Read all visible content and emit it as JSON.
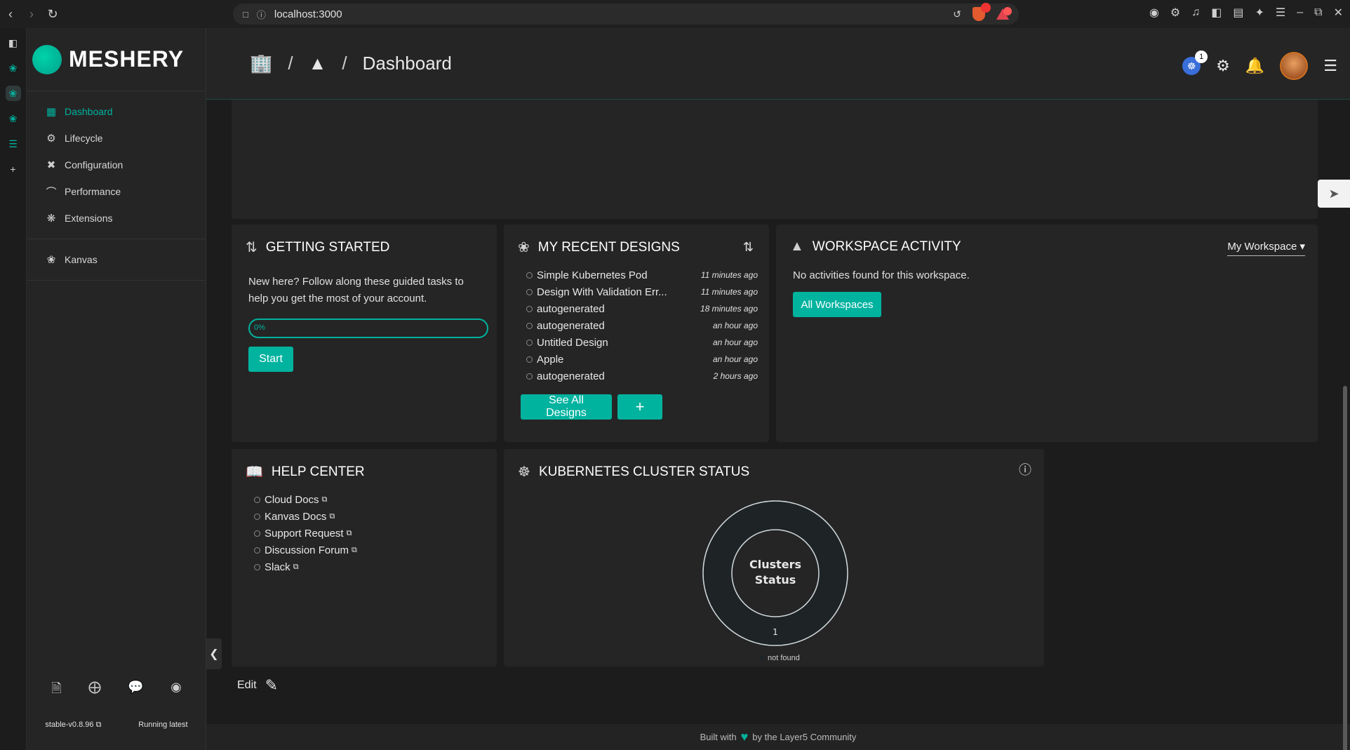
{
  "browser": {
    "url": "localhost:3000",
    "brave_badge": "",
    "back_label": "‹",
    "forward_label": "›",
    "reload_label": "↻"
  },
  "brand": {
    "name": "MESHERY"
  },
  "sidebar": {
    "items": [
      {
        "label": "Dashboard",
        "icon": "dashboard-icon",
        "active": true
      },
      {
        "label": "Lifecycle",
        "icon": "gears-icon"
      },
      {
        "label": "Configuration",
        "icon": "tools-icon"
      },
      {
        "label": "Performance",
        "icon": "gauge-icon"
      },
      {
        "label": "Extensions",
        "icon": "extensions-icon"
      }
    ],
    "extra_items": [
      {
        "label": "Kanvas",
        "icon": "kanvas-icon"
      }
    ],
    "version": "stable-v0.8.96",
    "running": "Running latest"
  },
  "header": {
    "breadcrumb_current": "Dashboard",
    "notification_count": "1"
  },
  "getting_started": {
    "title": "GETTING STARTED",
    "text": "New here? Follow along these guided tasks to help you get the most of your account.",
    "progress_label": "0%",
    "progress": 0,
    "start_label": "Start"
  },
  "recent_designs": {
    "title": "MY RECENT DESIGNS",
    "items": [
      {
        "name": "Simple Kubernetes Pod",
        "time": "11 minutes ago"
      },
      {
        "name": "Design With Validation Err...",
        "time": "11 minutes ago"
      },
      {
        "name": "autogenerated",
        "time": "18 minutes ago"
      },
      {
        "name": "autogenerated",
        "time": "an hour ago"
      },
      {
        "name": "Untitled Design",
        "time": "an hour ago"
      },
      {
        "name": "Apple",
        "time": "an hour ago"
      },
      {
        "name": "autogenerated",
        "time": "2 hours ago"
      }
    ],
    "see_all_label": "See All Designs",
    "add_label": "+"
  },
  "workspace_activity": {
    "title": "WORKSPACE ACTIVITY",
    "selected_workspace": "My Workspace",
    "empty_text": "No activities found for this workspace.",
    "all_workspaces_label": "All Workspaces"
  },
  "help_center": {
    "title": "HELP CENTER",
    "links": [
      "Cloud Docs",
      "Kanvas Docs",
      "Support Request",
      "Discussion Forum",
      "Slack"
    ]
  },
  "k8s_status": {
    "title": "KUBERNETES CLUSTER STATUS",
    "center_line1": "Clusters",
    "center_line2": "Status",
    "count": "1",
    "legend": "not found"
  },
  "edit_label": "Edit",
  "footer": {
    "before": "Built with",
    "after": "by the Layer5 Community"
  }
}
